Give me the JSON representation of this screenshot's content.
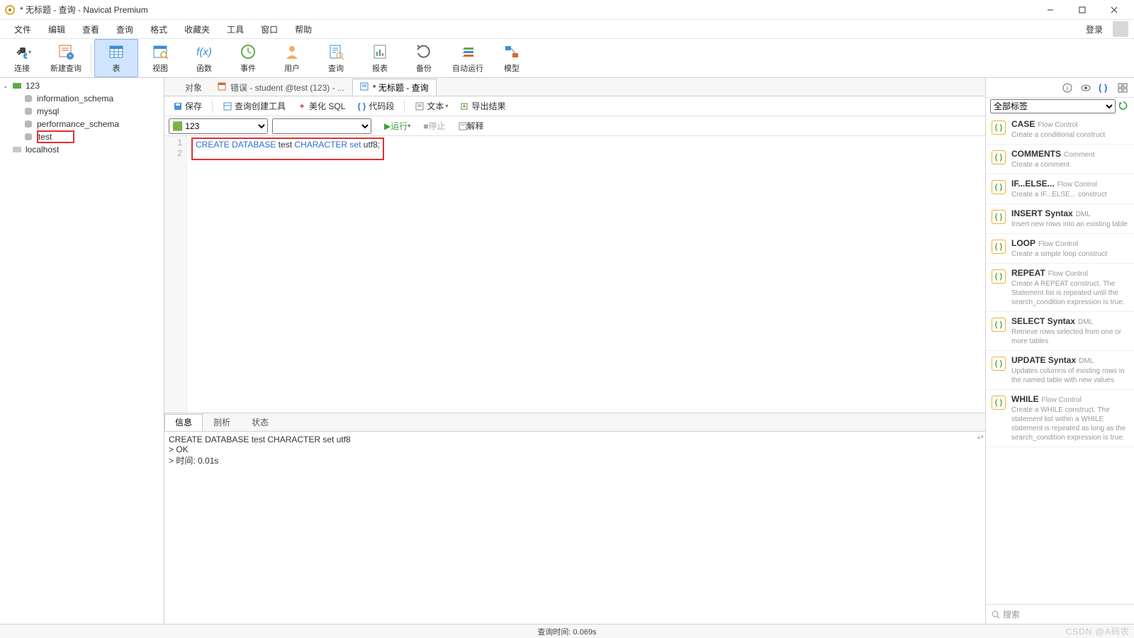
{
  "title": "* 无标题 - 查询 - Navicat Premium",
  "menu": [
    "文件",
    "编辑",
    "查看",
    "查询",
    "格式",
    "收藏夹",
    "工具",
    "窗口",
    "帮助"
  ],
  "login_label": "登录",
  "toolbar": [
    {
      "label": "连接",
      "icon": "plug",
      "drop": true
    },
    {
      "label": "新建查询",
      "icon": "newquery"
    },
    {
      "sep": true
    },
    {
      "label": "表",
      "icon": "table",
      "active": true
    },
    {
      "label": "视图",
      "icon": "view"
    },
    {
      "label": "函数",
      "icon": "fx"
    },
    {
      "label": "事件",
      "icon": "clock"
    },
    {
      "label": "用户",
      "icon": "user"
    },
    {
      "label": "查询",
      "icon": "query"
    },
    {
      "label": "报表",
      "icon": "report"
    },
    {
      "label": "备份",
      "icon": "backup"
    },
    {
      "label": "自动运行",
      "icon": "auto"
    },
    {
      "label": "模型",
      "icon": "model"
    }
  ],
  "tree": {
    "root": {
      "name": "123",
      "icon": "conn-green"
    },
    "dbs": [
      "information_schema",
      "mysql",
      "performance_schema",
      "test"
    ],
    "highlight_db": "test",
    "other_conn": "localhost"
  },
  "tabs": [
    {
      "label": "对象",
      "icon": "obj",
      "active": false
    },
    {
      "label": "错误 - student @test (123) - ...",
      "icon": "tbl",
      "active": false
    },
    {
      "label": "* 无标题 - 查询",
      "icon": "qry",
      "active": true
    }
  ],
  "query_actions": {
    "save": "保存",
    "builder": "查询创建工具",
    "beautify": "美化 SQL",
    "snippet": "代码段",
    "text": "文本",
    "export": "导出结果"
  },
  "run_row": {
    "conn": "123",
    "run": "运行",
    "stop": "停止",
    "explain": "解释"
  },
  "editor": {
    "lines": [
      "1",
      "2"
    ],
    "tokens": [
      {
        "t": "CREATE",
        "c": "kw"
      },
      {
        "t": " "
      },
      {
        "t": "DATABASE",
        "c": "kw"
      },
      {
        "t": " test "
      },
      {
        "t": "CHARACTER",
        "c": "kw"
      },
      {
        "t": " "
      },
      {
        "t": "set",
        "c": "kw"
      },
      {
        "t": " utf8;"
      }
    ]
  },
  "result": {
    "tabs": [
      "信息",
      "剖析",
      "状态"
    ],
    "output": "CREATE DATABASE test CHARACTER set utf8\n> OK\n> 时间: 0.01s"
  },
  "right_panel": {
    "tag_filter": "全部标签",
    "search_placeholder": "搜索",
    "snippets": [
      {
        "title": "CASE",
        "tag": "Flow Control",
        "desc": "Create a conditional construct"
      },
      {
        "title": "COMMENTS",
        "tag": "Comment",
        "desc": "Create a comment"
      },
      {
        "title": "IF...ELSE...",
        "tag": "Flow Control",
        "desc": "Create a IF...ELSE... construct"
      },
      {
        "title": "INSERT Syntax",
        "tag": "DML",
        "desc": "Insert new rows into an existing table"
      },
      {
        "title": "LOOP",
        "tag": "Flow Control",
        "desc": "Create a simple loop construct"
      },
      {
        "title": "REPEAT",
        "tag": "Flow Control",
        "desc": "Create A REPEAT construct. The Statement list is repeated until the search_condition expression is true."
      },
      {
        "title": "SELECT Syntax",
        "tag": "DML",
        "desc": "Retrieve rows selected from one or more tables"
      },
      {
        "title": "UPDATE Syntax",
        "tag": "DML",
        "desc": "Updates columns of existing rows in the named table with new values"
      },
      {
        "title": "WHILE",
        "tag": "Flow Control",
        "desc": "Create a WHILE construct. The statement list within a WHILE statement is repeated as long as the search_condition expression is true."
      }
    ]
  },
  "statusbar": {
    "query_time": "查询时间: 0.069s",
    "watermark": "CSDN @A码农"
  }
}
